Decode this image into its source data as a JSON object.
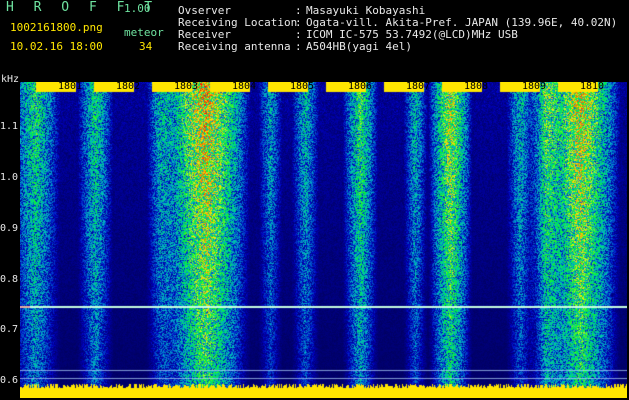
{
  "header": {
    "brand": "H R O F F T",
    "version": "1.00",
    "filename": "1002161800.png",
    "meteor_label": "meteor",
    "timestamp": "10.02.16 18:00",
    "meteor_count": "34",
    "fields": [
      {
        "label": "Ovserver",
        "value": "Masayuki Kobayashi"
      },
      {
        "label": "Receiving Location",
        "value": "Ogata-vill. Akita-Pref. JAPAN (139.96E, 40.02N)"
      },
      {
        "label": "Receiver",
        "value": "ICOM IC-575 53.7492(@LCD)MHz USB"
      },
      {
        "label": "Receiving antenna",
        "value": "A504HB(yagi 4el)"
      }
    ],
    "colon": ":"
  },
  "y_axis": {
    "unit": "kHz",
    "ticks": [
      "1.1",
      "1.0",
      "0.9",
      "0.8",
      "0.7",
      "0.6"
    ]
  },
  "x_axis": {
    "ticks": [
      "1801",
      "1802",
      "1803",
      "1804",
      "1805",
      "1806",
      "1807",
      "1808",
      "1809",
      "1810"
    ]
  },
  "colors": {
    "background": "#000000",
    "tick_bar": "#ffe600",
    "bright_band": "#ffe600"
  }
}
